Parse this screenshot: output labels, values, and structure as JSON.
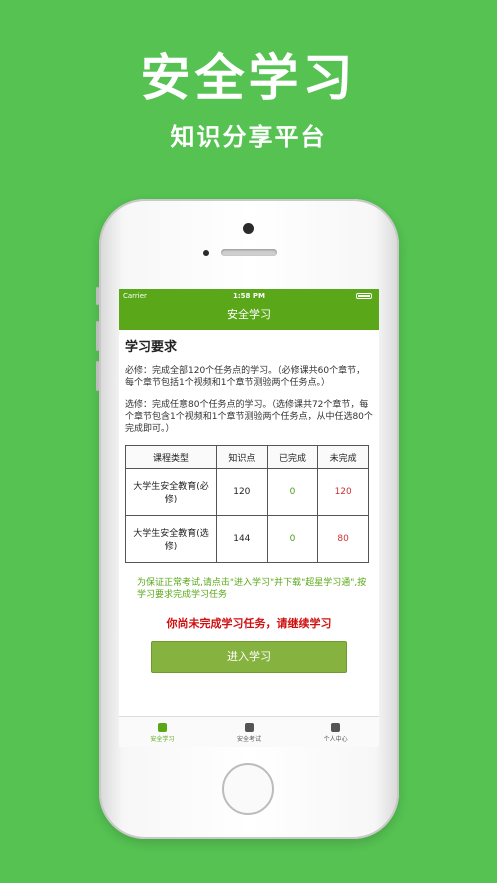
{
  "hero": {
    "title": "安全学习",
    "subtitle": "知识分享平台"
  },
  "statusbar": {
    "carrier": "Carrier",
    "time": "1:58 PM"
  },
  "navbar": {
    "title": "安全学习"
  },
  "main": {
    "section_title": "学习要求",
    "required_text": "必修：完成全部120个任务点的学习。（必修课共60个章节，每个章节包括1个视频和1个章节测验两个任务点。）",
    "elective_text": "选修：完成任意80个任务点的学习。（选修课共72个章节，每个章节包含1个视频和1个章节测验两个任务点，从中任选80个完成即可。）",
    "table": {
      "headers": [
        "课程类型",
        "知识点",
        "已完成",
        "未完成"
      ],
      "rows": [
        {
          "type": "大学生安全教育(必修)",
          "points": "120",
          "done": "0",
          "todo": "120"
        },
        {
          "type": "大学生安全教育(选修)",
          "points": "144",
          "done": "0",
          "todo": "80"
        }
      ]
    },
    "note": "为保证正常考试,请点击\"进入学习\"并下载\"超星学习通\",按学习要求完成学习任务",
    "warning": "你尚未完成学习任务，请继续学习",
    "enter_button": "进入学习"
  },
  "tabs": [
    {
      "label": "安全学习",
      "icon": "clipboard-icon",
      "active": true
    },
    {
      "label": "安全考试",
      "icon": "checklist-icon",
      "active": false
    },
    {
      "label": "个人中心",
      "icon": "person-icon",
      "active": false
    }
  ],
  "colors": {
    "background": "#55c252",
    "nav": "#5aa819",
    "done": "#4a9a1a",
    "todo": "#d03030",
    "button": "#86b340"
  }
}
